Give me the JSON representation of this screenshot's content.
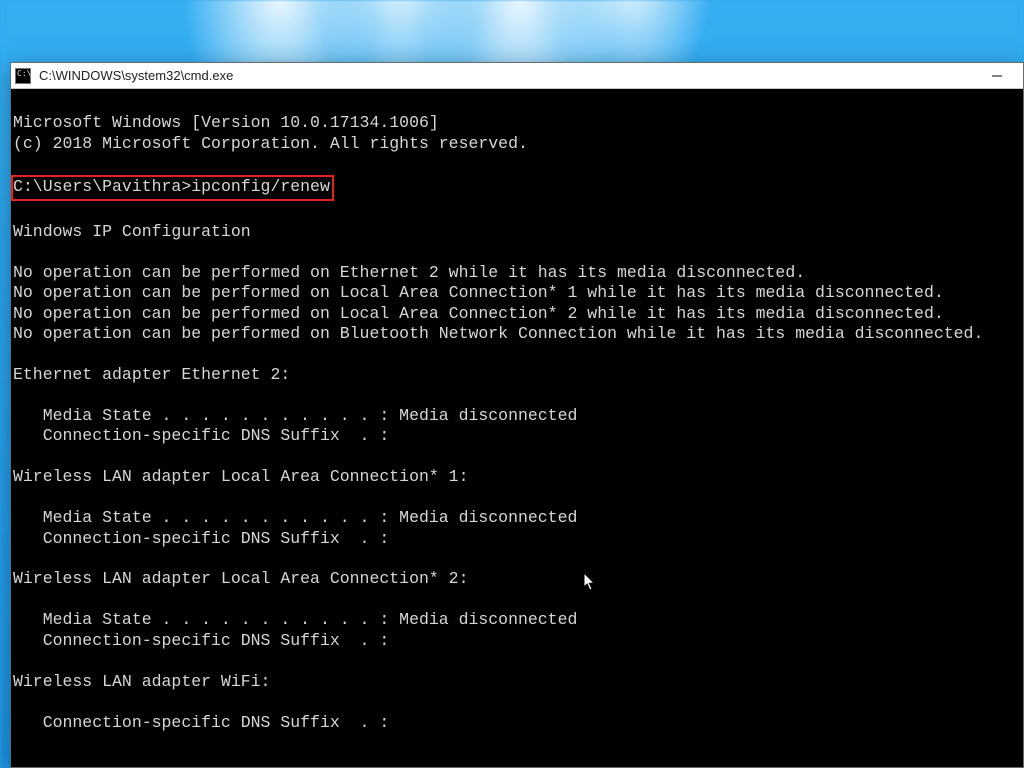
{
  "window": {
    "title": "C:\\WINDOWS\\system32\\cmd.exe"
  },
  "highlight": {
    "prompt": "C:\\Users\\Pavithra>",
    "command": "ipconfig/renew"
  },
  "term": {
    "l0": "Microsoft Windows [Version 10.0.17134.1006]",
    "l1": "(c) 2018 Microsoft Corporation. All rights reserved.",
    "blank": "",
    "l4": "Windows IP Configuration",
    "l6": "No operation can be performed on Ethernet 2 while it has its media disconnected.",
    "l7": "No operation can be performed on Local Area Connection* 1 while it has its media disconnected.",
    "l8": "No operation can be performed on Local Area Connection* 2 while it has its media disconnected.",
    "l9": "No operation can be performed on Bluetooth Network Connection while it has its media disconnected.",
    "l11": "Ethernet adapter Ethernet 2:",
    "l13": "   Media State . . . . . . . . . . . : Media disconnected",
    "l14": "   Connection-specific DNS Suffix  . :",
    "l16": "Wireless LAN adapter Local Area Connection* 1:",
    "l18": "   Media State . . . . . . . . . . . : Media disconnected",
    "l19": "   Connection-specific DNS Suffix  . :",
    "l21": "Wireless LAN adapter Local Area Connection* 2:",
    "l23": "   Media State . . . . . . . . . . . : Media disconnected",
    "l24": "   Connection-specific DNS Suffix  . :",
    "l26": "Wireless LAN adapter WiFi:",
    "l28": "   Connection-specific DNS Suffix  . :"
  }
}
